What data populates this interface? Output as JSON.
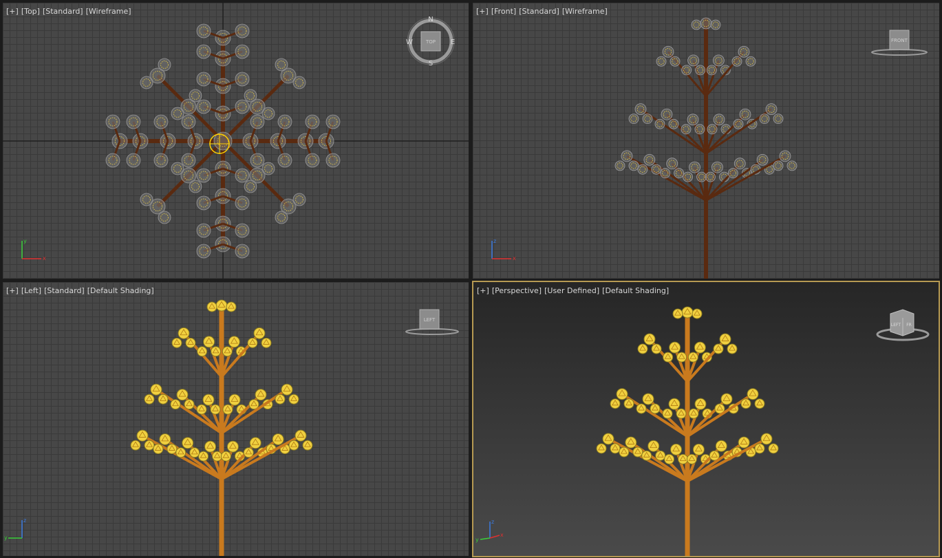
{
  "viewports": {
    "top": {
      "labels": [
        "[+]",
        "[Top]",
        "[Standard]",
        "[Wireframe]"
      ],
      "compass": {
        "n": "N",
        "s": "S",
        "e": "E",
        "w": "W",
        "cube": "TOP"
      }
    },
    "front": {
      "labels": [
        "[+]",
        "[Front]",
        "[Standard]",
        "[Wireframe]"
      ],
      "cube": "FRONT"
    },
    "left": {
      "labels": [
        "[+]",
        "[Left]",
        "[Standard]",
        "[Default Shading]"
      ],
      "cube": "LEFT"
    },
    "perspective": {
      "labels": [
        "[+]",
        "[Perspective]",
        "[User Defined]",
        "[Default Shading]"
      ],
      "cube_face": "LEFT",
      "cube_face2": "FR"
    }
  },
  "axes": {
    "x": "x",
    "y": "y",
    "z": "z"
  },
  "colors": {
    "branch_wire": "#5a2a10",
    "branch_shaded": "#c97a1e",
    "leaf": "#f0d040",
    "active_border": "#b79a52"
  }
}
